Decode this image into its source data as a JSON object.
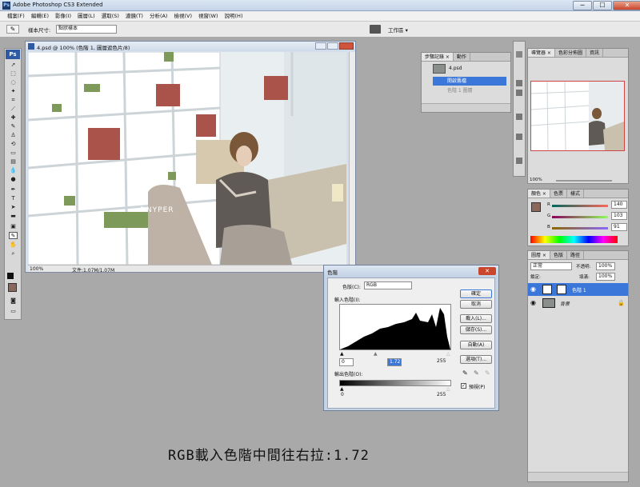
{
  "app": {
    "title": "Adobe Photoshop CS3 Extended",
    "min": "─",
    "max": "☐",
    "close": "✕"
  },
  "menu": [
    "檔案(F)",
    "編輯(E)",
    "影像(I)",
    "圖層(L)",
    "選取(S)",
    "濾鏡(T)",
    "分析(A)",
    "檢視(V)",
    "視窗(W)",
    "說明(H)"
  ],
  "options": {
    "sample_size_label": "樣本尺寸:",
    "sample_size_value": "點狀樣本",
    "workspace": "工作區 ▾"
  },
  "toolbox": {
    "logo": "Ps"
  },
  "document": {
    "title": "4.psd @ 100% (色階 1, 圖層遮色片/8)",
    "zoom": "100%",
    "file_info": "文件:1.07M/1.07M",
    "watermark": "DNYPER"
  },
  "history_panel": {
    "tabs": [
      "步驟記錄 ×",
      "動作"
    ],
    "snapshot": "4.psd",
    "items": [
      "開啟舊檔",
      "色階 1 圖層"
    ]
  },
  "navigator_panel": {
    "tabs": [
      "導覽器 ×",
      "色彩分佈圖",
      "資訊"
    ],
    "zoom": "100%"
  },
  "color_panel": {
    "tabs": [
      "顏色 ×",
      "色票",
      "樣式"
    ],
    "r_label": "R",
    "g_label": "G",
    "b_label": "B",
    "r": "140",
    "g": "103",
    "b": "91",
    "fg_color": "#8c675b"
  },
  "layers_panel": {
    "tabs": [
      "圖層 ×",
      "色版",
      "路徑"
    ],
    "blend": "正常",
    "opacity_label": "不透明:",
    "opacity": "100%",
    "lock_label": "鎖定:",
    "fill_label": "填滿:",
    "fill": "100%",
    "layers": [
      {
        "name": "色階 1"
      },
      {
        "name": "背景"
      }
    ]
  },
  "levels_dialog": {
    "title": "色階",
    "channel_label": "色版(C):",
    "channel": "RGB",
    "input_label": "輸入色階(I):",
    "input_black": "0",
    "input_gamma": "1.72",
    "input_white": "255",
    "output_label": "輸出色階(O):",
    "output_black": "0",
    "output_white": "255",
    "buttons": [
      "確定",
      "取消",
      "載入(L)...",
      "儲存(S)...",
      "自動(A)",
      "選項(T)..."
    ],
    "preview": "預視(P)"
  },
  "caption": "RGB載入色階中間往右拉:1.72"
}
